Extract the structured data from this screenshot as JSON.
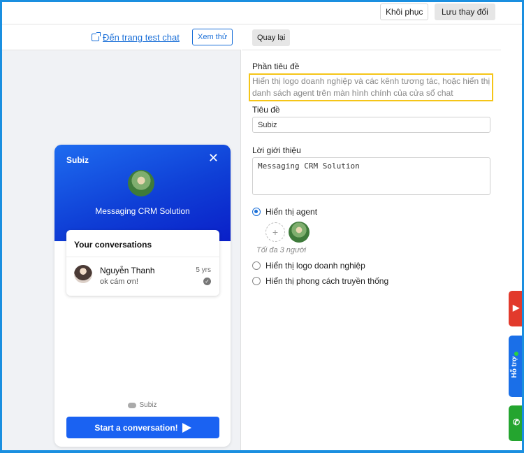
{
  "toolbar": {
    "restore_label": "Khôi phục",
    "save_label": "Lưu thay đổi"
  },
  "preview": {
    "test_link": "Đến trang test chat",
    "preview_button": "Xem thử"
  },
  "widget": {
    "brand": "Subiz",
    "description": "Messaging CRM Solution",
    "conversations_title": "Your conversations",
    "conversation": {
      "name": "Nguyễn Thanh",
      "message": "ok cám ơn!",
      "time": "5 yrs"
    },
    "powered_by": "Subiz",
    "start_button": "Start a conversation!"
  },
  "settings": {
    "back_button": "Quay lại",
    "header_section_label": "Phần tiêu đề",
    "header_section_desc": "Hiển thị logo doanh nghiệp và các kênh tương tác, hoặc hiển thị danh sách agent trên màn hình chính của cửa sổ chat",
    "title_label": "Tiêu đề",
    "title_value": "Subiz",
    "intro_label": "Lời giới thiệu",
    "intro_value": "Messaging CRM Solution",
    "options": [
      "Hiển thị agent",
      "Hiển thị logo doanh nghiệp",
      "Hiển thị phong cách truyền thống"
    ],
    "selected_option": "Hiển thị agent",
    "max_note": "Tối đa 3 người"
  },
  "side_tabs": {
    "support_label": "Hỗ trợ"
  },
  "colors": {
    "primary": "#1a6fd8",
    "widget_header": "#0f3fd6",
    "highlight": "#f5c518"
  }
}
